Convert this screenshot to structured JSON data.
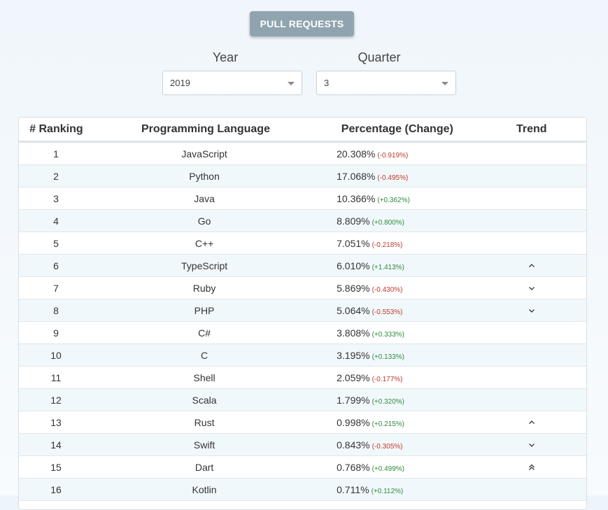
{
  "header": {
    "button_label": "PULL REQUESTS"
  },
  "filters": {
    "year_label": "Year",
    "year_value": "2019",
    "quarter_label": "Quarter",
    "quarter_value": "3"
  },
  "table": {
    "columns": [
      "# Ranking",
      "Programming Language",
      "Percentage (Change)",
      "Trend"
    ],
    "rows": [
      {
        "rank": "1",
        "language": "JavaScript",
        "pct": "20.308%",
        "change": "(-0.919%)",
        "dir": "neg",
        "trend": ""
      },
      {
        "rank": "2",
        "language": "Python",
        "pct": "17.068%",
        "change": "(-0.495%)",
        "dir": "neg",
        "trend": ""
      },
      {
        "rank": "3",
        "language": "Java",
        "pct": "10.366%",
        "change": "(+0.362%)",
        "dir": "pos",
        "trend": ""
      },
      {
        "rank": "4",
        "language": "Go",
        "pct": "8.809%",
        "change": "(+0.800%)",
        "dir": "pos",
        "trend": ""
      },
      {
        "rank": "5",
        "language": "C++",
        "pct": "7.051%",
        "change": "(-0.218%)",
        "dir": "neg",
        "trend": ""
      },
      {
        "rank": "6",
        "language": "TypeScript",
        "pct": "6.010%",
        "change": "(+1.413%)",
        "dir": "pos",
        "trend": "up"
      },
      {
        "rank": "7",
        "language": "Ruby",
        "pct": "5.869%",
        "change": "(-0.430%)",
        "dir": "neg",
        "trend": "down"
      },
      {
        "rank": "8",
        "language": "PHP",
        "pct": "5.064%",
        "change": "(-0.553%)",
        "dir": "neg",
        "trend": "down"
      },
      {
        "rank": "9",
        "language": "C#",
        "pct": "3.808%",
        "change": "(+0.333%)",
        "dir": "pos",
        "trend": ""
      },
      {
        "rank": "10",
        "language": "C",
        "pct": "3.195%",
        "change": "(+0.133%)",
        "dir": "pos",
        "trend": ""
      },
      {
        "rank": "11",
        "language": "Shell",
        "pct": "2.059%",
        "change": "(-0.177%)",
        "dir": "neg",
        "trend": ""
      },
      {
        "rank": "12",
        "language": "Scala",
        "pct": "1.799%",
        "change": "(+0.320%)",
        "dir": "pos",
        "trend": ""
      },
      {
        "rank": "13",
        "language": "Rust",
        "pct": "0.998%",
        "change": "(+0.215%)",
        "dir": "pos",
        "trend": "up"
      },
      {
        "rank": "14",
        "language": "Swift",
        "pct": "0.843%",
        "change": "(-0.305%)",
        "dir": "neg",
        "trend": "down"
      },
      {
        "rank": "15",
        "language": "Dart",
        "pct": "0.768%",
        "change": "(+0.499%)",
        "dir": "pos",
        "trend": "double-up"
      },
      {
        "rank": "16",
        "language": "Kotlin",
        "pct": "0.711%",
        "change": "(+0.112%)",
        "dir": "pos",
        "trend": ""
      }
    ]
  },
  "colors": {
    "button_bg": "#8fa4ae",
    "negative": "#c0392b",
    "positive": "#2e8b3a",
    "row_alt": "#f1f8fc"
  },
  "icons": {
    "up": "chevron-up-icon",
    "down": "chevron-down-icon",
    "double-up": "double-chevron-up-icon",
    "select_caret": "caret-down-icon"
  }
}
